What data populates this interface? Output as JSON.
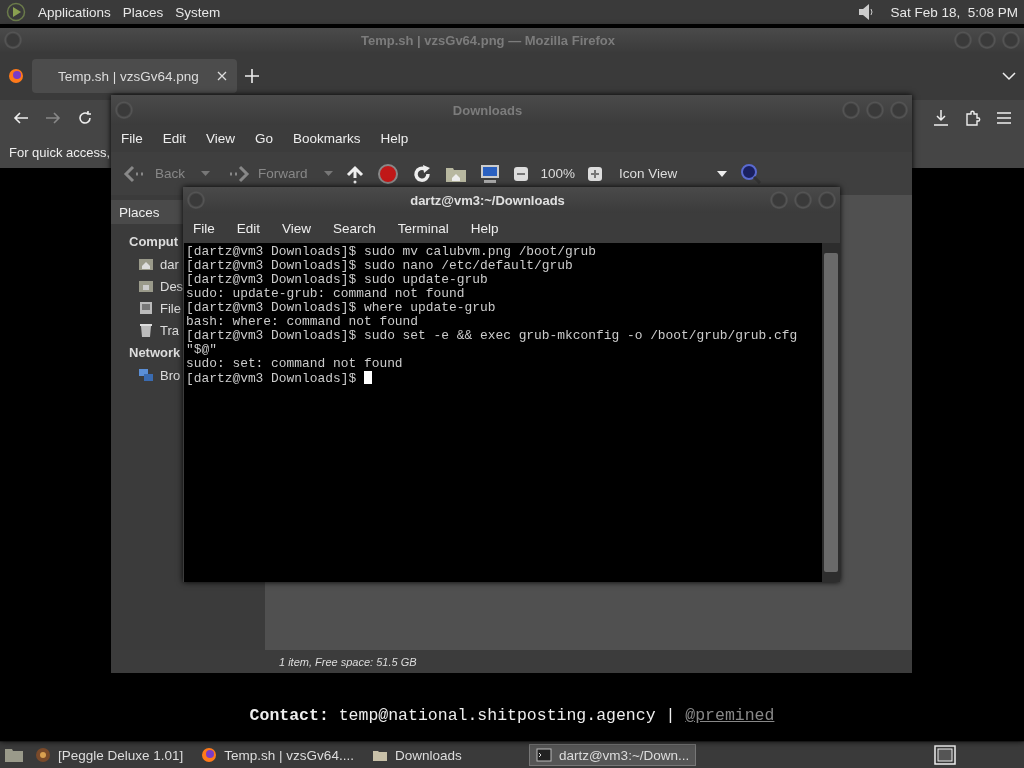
{
  "top_panel": {
    "menus": [
      "Applications",
      "Places",
      "System"
    ],
    "clock": "Sat Feb 18,  5:08 PM"
  },
  "firefox": {
    "title": "Temp.sh | vzsGv64.png — Mozilla Firefox",
    "tabs": [
      {
        "label": "Temp.sh | vzsGv64.png",
        "selected": true
      }
    ],
    "nav_buttons": [
      {
        "kind": "back",
        "disabled": false
      },
      {
        "kind": "forward",
        "disabled": true
      },
      {
        "kind": "reload",
        "disabled": false
      }
    ],
    "bookmarks_hint": "For quick access,",
    "contact": {
      "text": "**Contact:** temp@national.shitposting.agency |",
      "link": "@premined"
    }
  },
  "files": {
    "title": "Downloads",
    "menus": [
      "File",
      "Edit",
      "View",
      "Go",
      "Bookmarks",
      "Help"
    ],
    "back": {
      "label": "Back",
      "disabled": true
    },
    "forward": {
      "label": "Forward",
      "disabled": true
    },
    "zoom": "100%",
    "view": "Icon View",
    "sidebar": {
      "header": "Places",
      "items": [
        {
          "kind": "heading",
          "label": "Comput"
        },
        {
          "kind": "home",
          "label": "dar"
        },
        {
          "kind": "desktop",
          "label": "Des"
        },
        {
          "kind": "drive",
          "label": "File"
        },
        {
          "kind": "trash",
          "label": "Tra"
        },
        {
          "kind": "heading",
          "label": "Network"
        },
        {
          "kind": "network",
          "label": "Bro"
        }
      ]
    },
    "status": "1 item, Free space: 51.5 GB"
  },
  "terminal": {
    "title": "dartz@vm3:~/Downloads",
    "menus": [
      "File",
      "Edit",
      "View",
      "Search",
      "Terminal",
      "Help"
    ],
    "lines": [
      "[dartz@vm3 Downloads]$ sudo mv calubvm.png /boot/grub",
      "[dartz@vm3 Downloads]$ sudo nano /etc/default/grub",
      "[dartz@vm3 Downloads]$ sudo update-grub",
      "sudo: update-grub: command not found",
      "[dartz@vm3 Downloads]$ where update-grub",
      "bash: where: command not found",
      "[dartz@vm3 Downloads]$ sudo set -e && exec grub-mkconfig -o /boot/grub/grub.cfg",
      "\"$@\"",
      "sudo: set: command not found",
      "[dartz@vm3 Downloads]$ "
    ]
  },
  "taskbar": {
    "items": [
      {
        "kind": "game",
        "label": "[Peggle Deluxe 1.01]",
        "selected": false
      },
      {
        "kind": "browser",
        "label": "Temp.sh | vzsGv64....",
        "selected": false
      },
      {
        "kind": "folder",
        "label": "Downloads",
        "selected": false
      },
      {
        "kind": "terminal",
        "label": "dartz@vm3:~/Down...",
        "selected": true
      }
    ]
  }
}
